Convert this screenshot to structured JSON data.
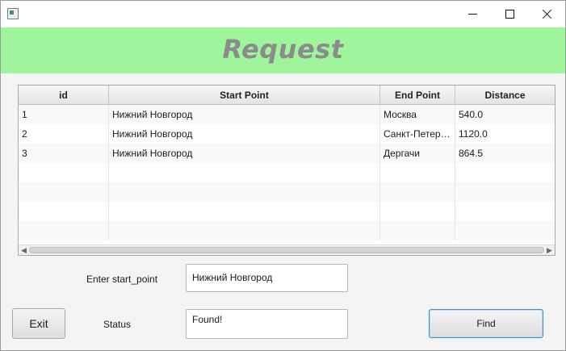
{
  "window": {
    "title": "",
    "controls": {
      "minimize": "minimize-icon",
      "maximize": "maximize-icon",
      "close": "close-icon"
    }
  },
  "banner": {
    "title": "Request",
    "background": "#9ff59b",
    "title_color": "#8b8b8b"
  },
  "table": {
    "columns": [
      "id",
      "Start Point",
      "End Point",
      "Distance"
    ],
    "rows": [
      [
        "1",
        "Нижний Новгород",
        "Москва",
        "540.0"
      ],
      [
        "2",
        "Нижний Новгород",
        "Санкт-Петербург",
        "1120.0"
      ],
      [
        "3",
        "Нижний Новгород",
        "Дергачи",
        "864.5"
      ]
    ],
    "empty_rows": 4
  },
  "form": {
    "start_label": "Enter start_point",
    "start_value": "Нижний Новгород",
    "status_label": "Status",
    "status_value": "Found!",
    "exit_label": "Exit",
    "find_label": "Find",
    "accent": "#3c8fd6"
  }
}
